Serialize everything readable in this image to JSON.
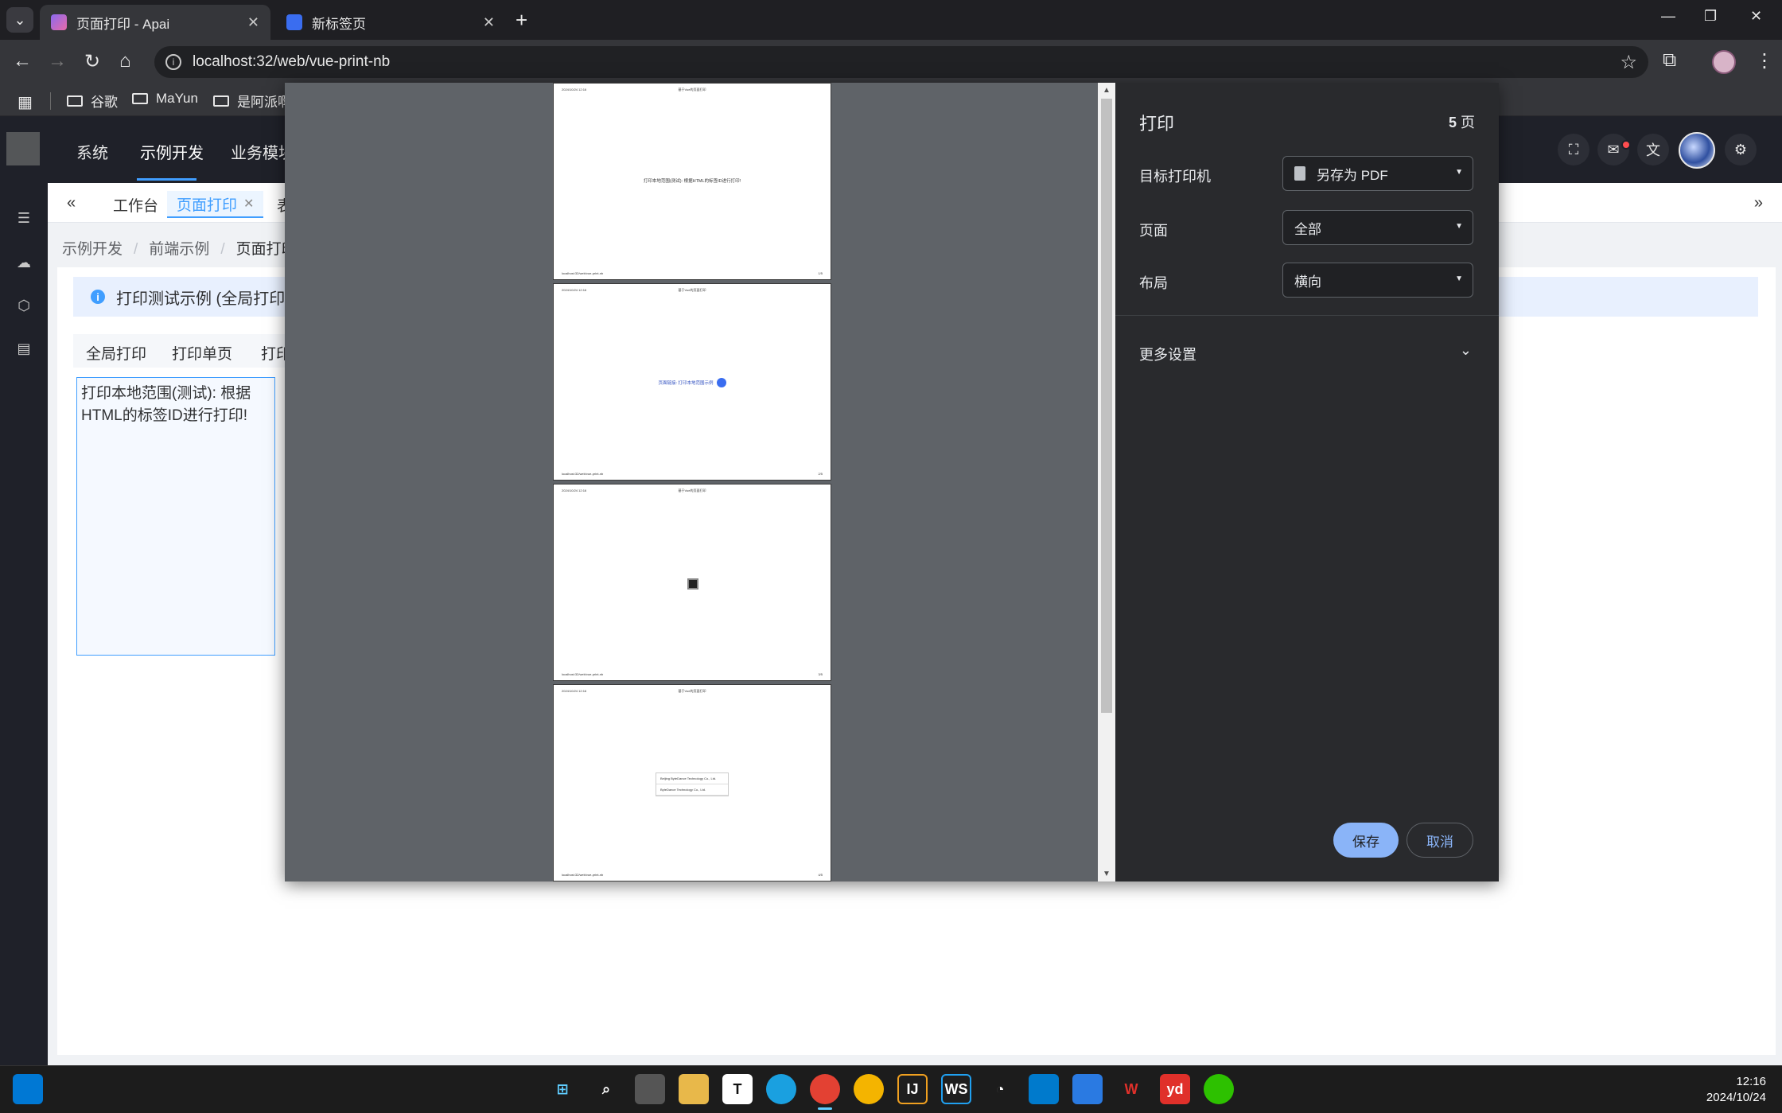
{
  "browser": {
    "tabs": [
      {
        "title": "页面打印 - Apai",
        "active": true
      },
      {
        "title": "新标签页",
        "active": false
      }
    ],
    "url": "localhost:32/web/vue-print-nb",
    "bookmarks": [
      "谷歌",
      "MaYun",
      "是阿派啊"
    ]
  },
  "app": {
    "topnav": [
      "系统",
      "示例开发",
      "业务模块"
    ],
    "active_topnav": "示例开发",
    "page_tabs": [
      "工作台",
      "页面打印",
      "表"
    ],
    "breadcrumb": [
      "示例开发",
      "前端示例",
      "页面打印"
    ],
    "alert_text": "打印测试示例 (全局打印 / 打",
    "buttons": [
      "全局打印",
      "打印单页",
      "打印"
    ],
    "print_area_text": "打印本地范围(测试): 根据HTML的标签ID进行打印!"
  },
  "print_dialog": {
    "title": "打印",
    "page_count": "5",
    "page_unit": "页",
    "destination_label": "目标打印机",
    "destination_value": "另存为 PDF",
    "pages_label": "页面",
    "pages_value": "全部",
    "layout_label": "布局",
    "layout_value": "横向",
    "more_settings": "更多设置",
    "save": "保存",
    "cancel": "取消",
    "sheet_date": "2024/10/24 12:16",
    "sheet_header": "基于Vue的页面打印",
    "sheet_footer_url": "localhost:32/web/vue-print-nb",
    "sheets": [
      {
        "page": "1/5",
        "body": "打印本地范围(测试): 根据HTML的标签ID进行打印!"
      },
      {
        "page": "2/5",
        "body": "页面链接: 打印本地范围示例"
      },
      {
        "page": "3/5",
        "body": ""
      },
      {
        "page": "4/5",
        "rows": [
          "Beijing ByteDance Technology Co., Ltd.",
          "ByteDance Technology Co., Ltd."
        ]
      }
    ]
  },
  "taskbar": {
    "time": "12:16",
    "date": "2024/10/24"
  },
  "colors": {
    "accent": "#409eff",
    "dialog_button": "#8ab4f8"
  }
}
